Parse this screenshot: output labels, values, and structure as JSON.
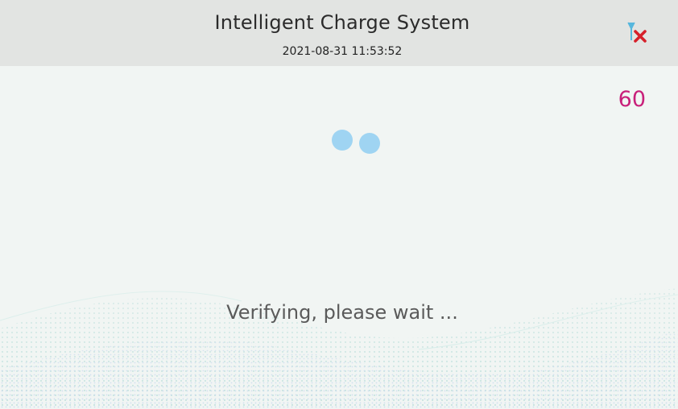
{
  "header": {
    "title": "Intelligent Charge System",
    "datetime": "2021-08-31 11:53:52",
    "signal_icon": "no-signal-antenna-icon"
  },
  "main": {
    "countdown": "60",
    "status_message": "Verifying, please wait ...",
    "spinner": "loading-dots"
  },
  "colors": {
    "header_bg": "#e2e4e2",
    "countdown": "#c8207a",
    "spinner_dots": "#9fd4f2",
    "signal_icon": "#57b7dd",
    "signal_error": "#d6202a"
  }
}
